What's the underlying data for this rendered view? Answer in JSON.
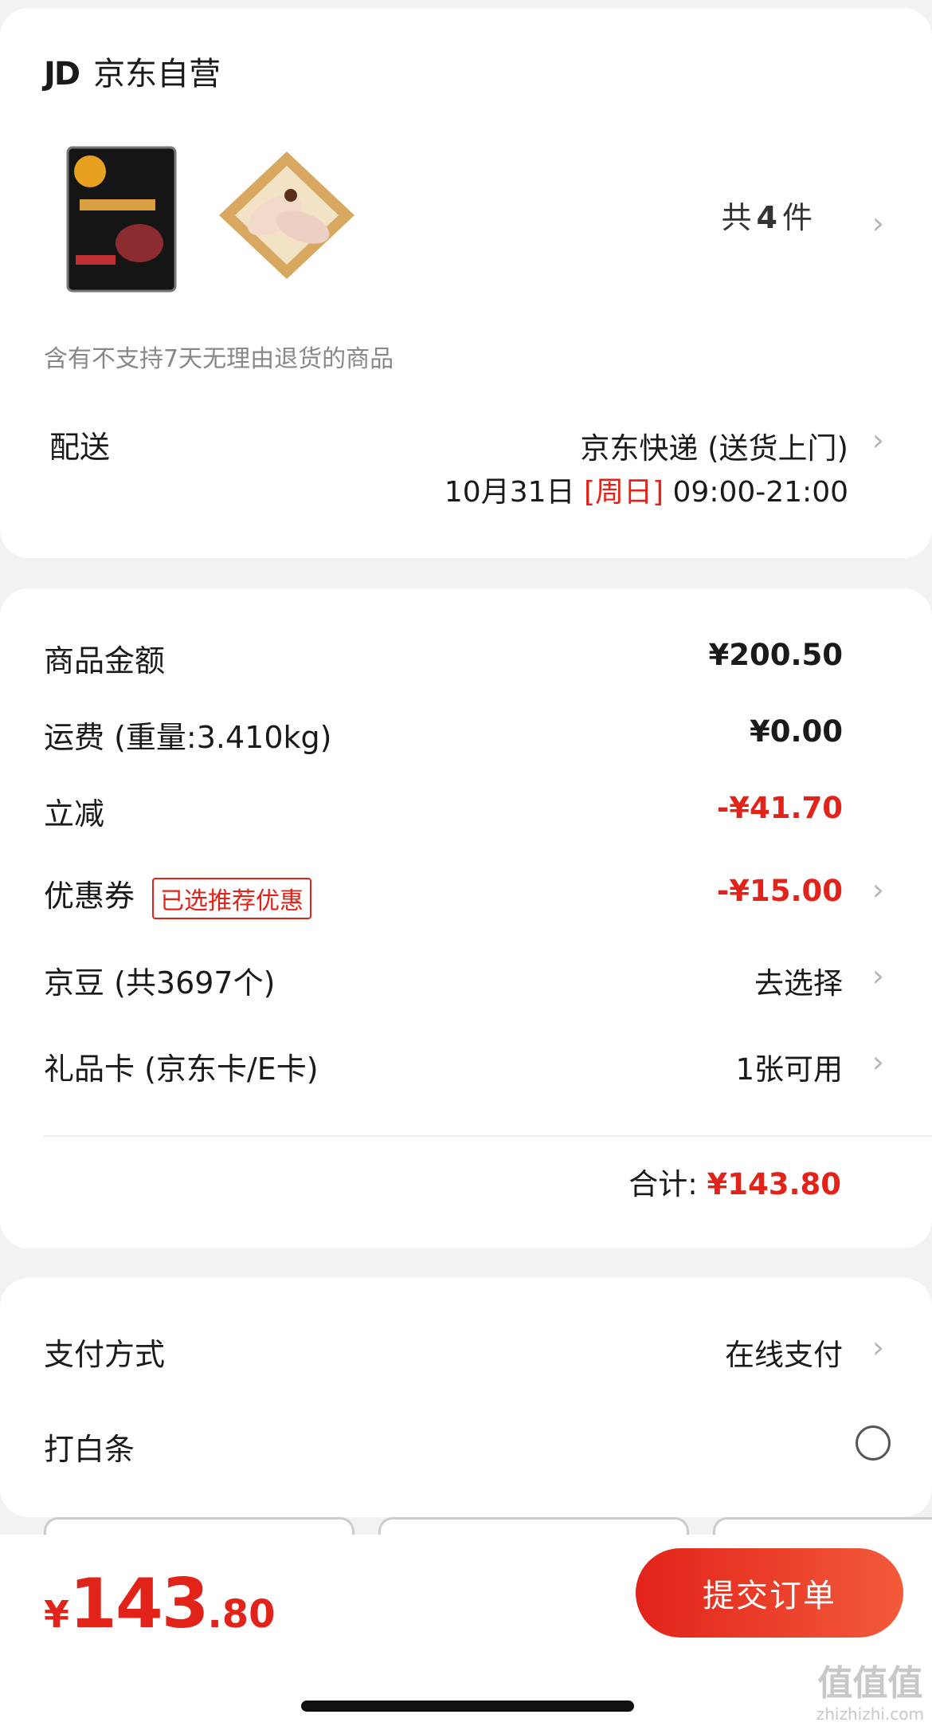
{
  "shop": {
    "logo_text": "JD",
    "name": "京东自营",
    "qty_prefix": "共",
    "qty_count": "4",
    "qty_suffix": "件",
    "notice": "含有不支持7天无理由退货的商品"
  },
  "delivery": {
    "label": "配送",
    "method": "京东快递 (送货上门)",
    "date": "10月31日",
    "weekday": "[周日]",
    "time": "09:00-21:00"
  },
  "price": {
    "goods_label": "商品金额",
    "goods_value": "¥200.50",
    "shipping_label": "运费 (重量:3.410kg)",
    "shipping_value": "¥0.00",
    "discount_label": "立减",
    "discount_value": "-¥41.70",
    "coupon_label": "优惠券",
    "coupon_tag": "已选推荐优惠",
    "coupon_value": "-¥15.00",
    "jingdou_label": "京豆 (共3697个)",
    "jingdou_value": "去选择",
    "giftcard_label": "礼品卡 (京东卡/E卡)",
    "giftcard_value": "1张可用",
    "total_label": "合计:",
    "total_value": "¥143.80"
  },
  "payment": {
    "method_label": "支付方式",
    "method_value": "在线支付",
    "baitiao_label": "打白条"
  },
  "bottom": {
    "yen": "¥",
    "amount_int": "143",
    "amount_dec": ".80",
    "submit_label": "提交订单"
  },
  "watermark": {
    "text": "值值值",
    "url": "zhizhizhi.com"
  },
  "colors": {
    "accent": "#e2231a",
    "background": "#f2f2f2"
  }
}
